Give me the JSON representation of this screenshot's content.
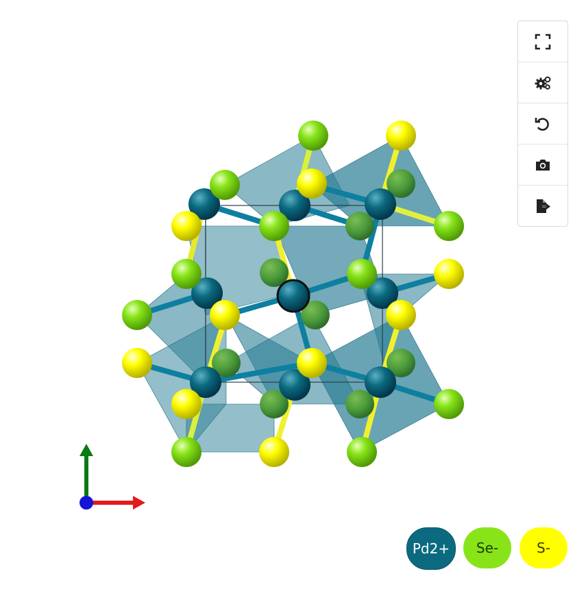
{
  "toolbar": {
    "buttons": [
      {
        "name": "fullscreen-button",
        "icon": "fullscreen-icon"
      },
      {
        "name": "settings-button",
        "icon": "gears-icon"
      },
      {
        "name": "reset-view-button",
        "icon": "undo-icon"
      },
      {
        "name": "screenshot-button",
        "icon": "camera-icon"
      },
      {
        "name": "export-button",
        "icon": "file-export-icon"
      }
    ]
  },
  "legend": {
    "items": [
      {
        "label": "Pd2+",
        "color": "#0b6a80",
        "text_color": "#ffffff"
      },
      {
        "label": "Se-",
        "color": "#88e419",
        "text_color": "#1b3a00"
      },
      {
        "label": "S-",
        "color": "#ffff00",
        "text_color": "#3a3a00"
      }
    ]
  },
  "axes": {
    "x_color": "#e21b1b",
    "y_color": "#0c7a12",
    "z_color": "#1515d6"
  },
  "colors": {
    "pd": "#0b6a80",
    "se": "#88e419",
    "s": "#ffff00",
    "polyhedra": "#2a7d94"
  }
}
